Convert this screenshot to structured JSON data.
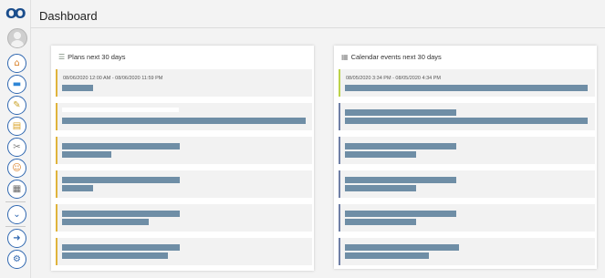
{
  "header": {
    "title": "Dashboard"
  },
  "nav": {
    "logo": "OO",
    "buttons": [
      {
        "name": "home-icon",
        "glyph": "⌂",
        "color": "#d9822b"
      },
      {
        "name": "chat-icon",
        "glyph": "▬",
        "color": "#2f86d6"
      },
      {
        "name": "edit-note-icon",
        "glyph": "✎",
        "color": "#c9a227"
      },
      {
        "name": "folder-icon",
        "glyph": "▤",
        "color": "#d9a227"
      },
      {
        "name": "tools-icon",
        "glyph": "✂",
        "color": "#7a7a7a"
      },
      {
        "name": "person-icon",
        "glyph": "☺",
        "color": "#d9822b"
      },
      {
        "name": "calendar-icon",
        "glyph": "▦",
        "color": "#6b6b6b"
      },
      {
        "name": "chevron-down-icon",
        "glyph": "⌄",
        "color": "#2f67b0"
      },
      {
        "name": "logout-icon",
        "glyph": "➜",
        "color": "#2f67b0"
      },
      {
        "name": "settings-icon",
        "glyph": "⚙",
        "color": "#2f67b0"
      }
    ]
  },
  "plans": {
    "title": "Plans next 30 days",
    "icon": "plan-list-icon",
    "accent": "#e0b43c",
    "first_item_time": "08/06/2020 12:00 AM - 08/06/2020 11:59 PM"
  },
  "calendar": {
    "title": "Calendar events next 30 days",
    "icon": "calendar-icon",
    "first_accent": "#bcd24a",
    "accent": "#6f7fa6",
    "first_item_time": "08/05/2020 3:34 PM - 08/05/2020 4:34 PM"
  }
}
